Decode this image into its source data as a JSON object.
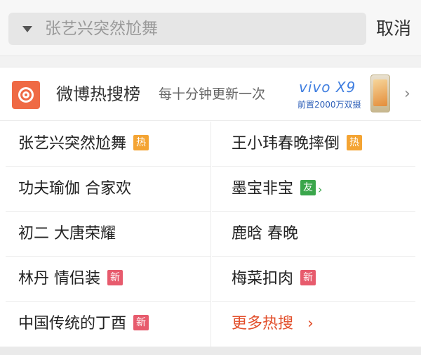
{
  "search": {
    "text": "张艺兴突然尬舞"
  },
  "cancel_label": "取消",
  "hot": {
    "title": "微博热搜榜",
    "subtitle": "每十分钟更新一次",
    "ad": {
      "brand": "vivo X9",
      "text": "前置2000万双摄"
    },
    "chevron": "›"
  },
  "items": [
    {
      "label": "张艺兴突然尬舞",
      "badge": "热"
    },
    {
      "label": "王小玮春晚摔倒",
      "badge": "热"
    },
    {
      "label": "功夫瑜伽 合家欢",
      "badge": ""
    },
    {
      "label": "墨宝非宝",
      "badge": "友"
    },
    {
      "label": "初二 大唐荣耀",
      "badge": ""
    },
    {
      "label": "鹿晗 春晚",
      "badge": ""
    },
    {
      "label": "林丹 情侣装",
      "badge": "新"
    },
    {
      "label": "梅菜扣肉",
      "badge": "新"
    },
    {
      "label": "中国传统的丁酉",
      "badge": "新"
    }
  ],
  "more": {
    "label": "更多热搜",
    "chevron": "›"
  },
  "colors": {
    "hot": "#f4a433",
    "new": "#e75b6d",
    "friend": "#3aa64b",
    "accent": "#e24e2a",
    "logo": "#ef6a45"
  },
  "icons": {
    "dropdown": "caret-down-icon",
    "logo": "weibo-hot-search-icon"
  }
}
